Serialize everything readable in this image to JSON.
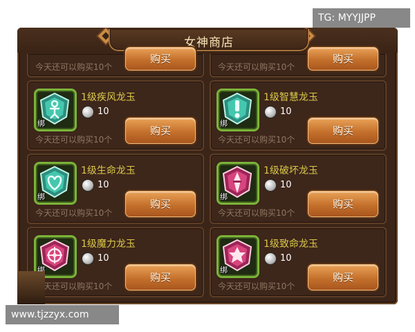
{
  "watermarks": {
    "tg": "TG: MYYJJPP",
    "site": "www.tjzzyx.com"
  },
  "shop": {
    "title": "女神商店",
    "buy_label": "购买",
    "bind_label": "绑",
    "limit_text": "今天还可以购买10个",
    "partial_items": [
      {
        "limit": "今天还可以购买10个"
      },
      {
        "limit": "今天还可以购买10个"
      }
    ],
    "items": [
      {
        "name": "1级疾风龙玉",
        "price": "10",
        "limit": "今天还可以购买10个",
        "icon": "wind-jade-icon",
        "theme": "#3fb8a3"
      },
      {
        "name": "1级智慧龙玉",
        "price": "10",
        "limit": "今天还可以购买10个",
        "icon": "wisdom-jade-icon",
        "theme": "#3fb8a3"
      },
      {
        "name": "1级生命龙玉",
        "price": "10",
        "limit": "今天还可以购买10个",
        "icon": "life-jade-icon",
        "theme": "#3fb8a3"
      },
      {
        "name": "1级破坏龙玉",
        "price": "10",
        "limit": "今天还可以购买10个",
        "icon": "destruction-jade-icon",
        "theme": "#d8457e"
      },
      {
        "name": "1级魔力龙玉",
        "price": "10",
        "limit": "今天还可以购买10个",
        "icon": "magic-jade-icon",
        "theme": "#d8457e"
      },
      {
        "name": "1级致命龙玉",
        "price": "10",
        "limit": "今天还可以购买10个",
        "icon": "lethal-jade-icon",
        "theme": "#d8457e"
      }
    ]
  }
}
